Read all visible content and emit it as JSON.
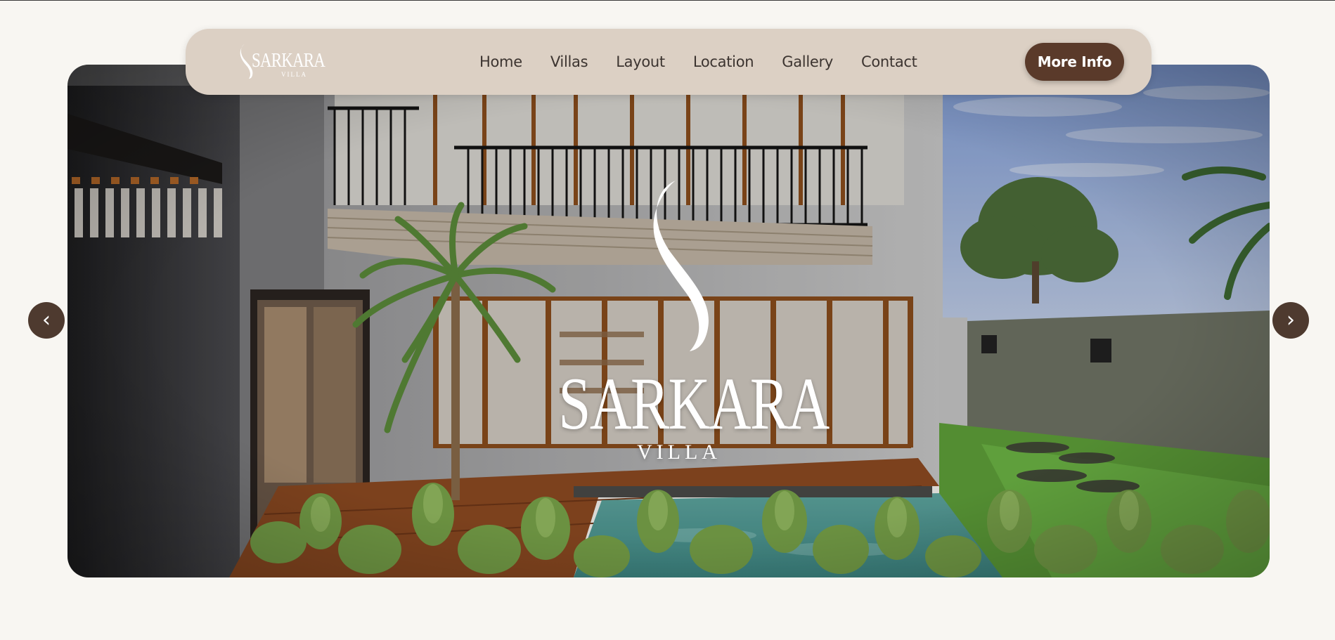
{
  "nav": {
    "logo": {
      "word": "SARKARA",
      "sub": "VILLA"
    },
    "links": [
      "Home",
      "Villas",
      "Layout",
      "Location",
      "Gallery",
      "Contact"
    ],
    "cta_label": "More Info"
  },
  "hero": {
    "brand": "SARKARA",
    "sub": "VILLA",
    "prev_glyph": "‹",
    "next_glyph": "›",
    "prev_icon": "chevron-left-icon",
    "next_icon": "chevron-right-icon"
  },
  "colors": {
    "background": "#f8f6f2",
    "navbar": "#dcd0c4",
    "accent": "#5a3a2a",
    "arrow": "#4e3a2f",
    "nav_text": "#3c3430"
  }
}
